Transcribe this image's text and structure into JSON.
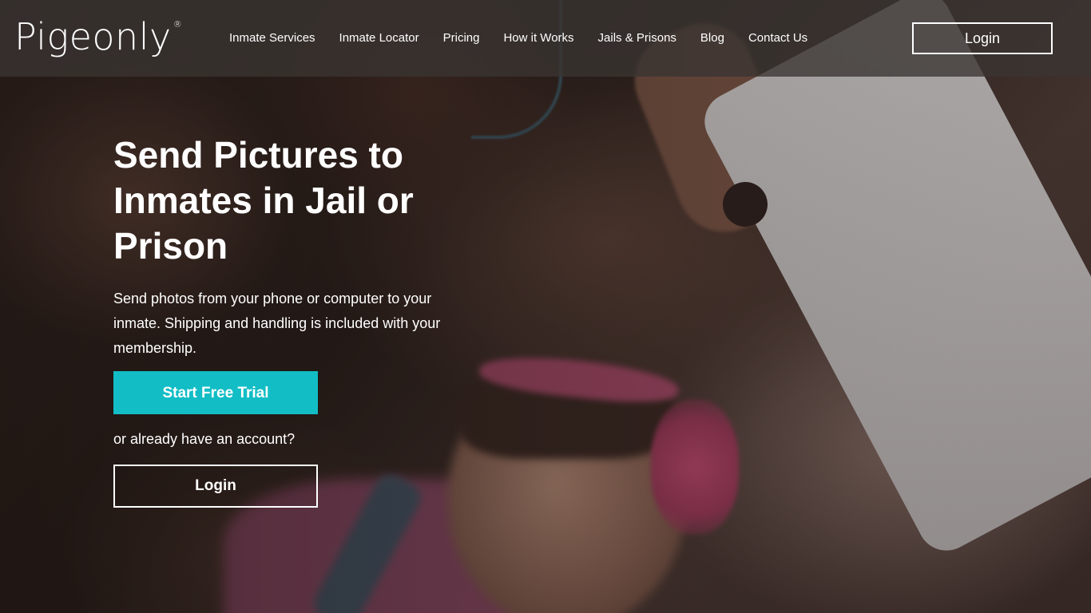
{
  "brand": {
    "logo_text": "Pigeonly",
    "registered_mark": "®"
  },
  "nav": {
    "items": [
      {
        "label": "Inmate Services"
      },
      {
        "label": "Inmate Locator"
      },
      {
        "label": "Pricing"
      },
      {
        "label": "How it Works"
      },
      {
        "label": "Jails & Prisons"
      },
      {
        "label": "Blog"
      },
      {
        "label": "Contact Us"
      }
    ],
    "login_label": "Login"
  },
  "hero": {
    "title": "Send Pictures to Inmates in Jail or Prison",
    "subtitle": "Send photos from your phone or computer to your inmate. Shipping and handling is included with your membership.",
    "cta_primary_label": "Start Free Trial",
    "already_text": "or already have an account?",
    "cta_login_label": "Login"
  },
  "colors": {
    "accent": "#12bdc5",
    "header_bg": "#3a3432"
  }
}
